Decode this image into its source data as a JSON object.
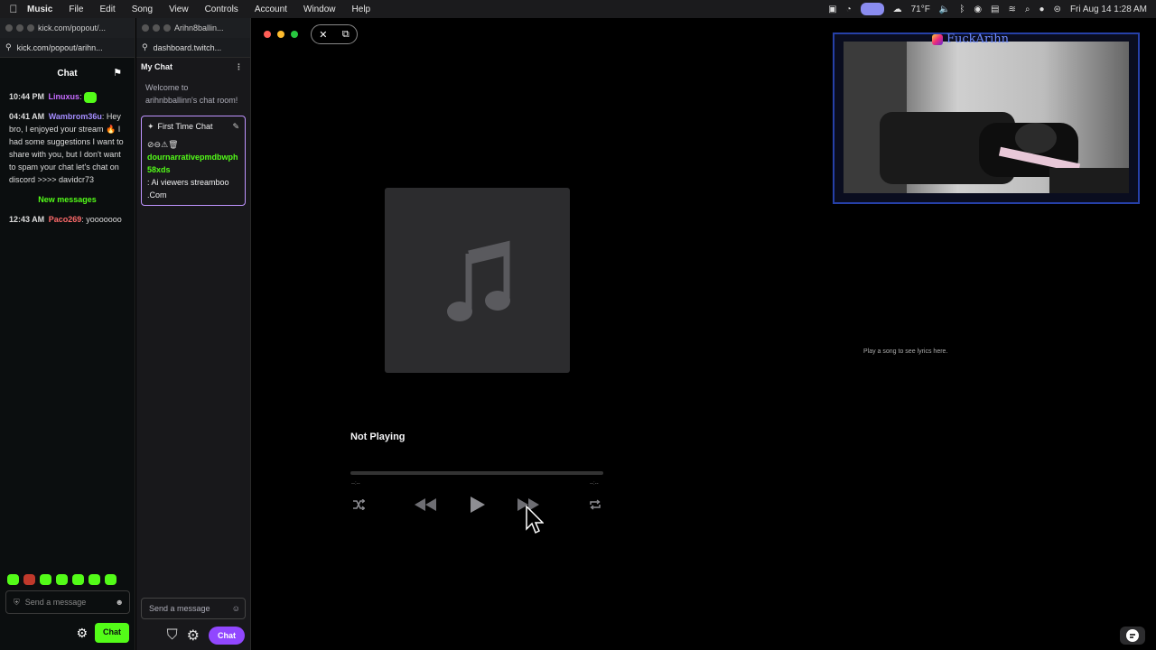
{
  "menubar": {
    "app_name": "Music",
    "menus": [
      "File",
      "Edit",
      "Song",
      "View",
      "Controls",
      "Account",
      "Window",
      "Help"
    ],
    "weather": "71°F",
    "datetime": "Fri Aug 14  1:28 AM"
  },
  "kick": {
    "tab_title": "kick.com/popout/...",
    "url": "kick.com/popout/arihn...",
    "header": "Chat",
    "messages": [
      {
        "time": "10:44 PM",
        "user": "Linuxus",
        "sep": ":",
        "text": ""
      },
      {
        "time": "04:41 AM",
        "user": "Wambrom36u",
        "sep": ":",
        "text": "Hey bro, I enjoyed your stream 🔥 I had some suggestions I want to share with you, but I don't want to spam your chat let's chat on discord >>>> davidcr73"
      },
      {
        "time": "12:43 AM",
        "user": "Paco269",
        "sep": ":",
        "text": "yooooooo"
      }
    ],
    "new_messages": "New messages",
    "input_placeholder": "Send a message",
    "chat_button": "Chat",
    "user_colors": {
      "Linuxus": "#c66cff",
      "Wambrom36u": "#a58dff",
      "Paco269": "#ff6b6b"
    }
  },
  "twitch": {
    "tab_title": "Arihn8ballin...",
    "url": "dashboard.twitch...",
    "header": "My Chat",
    "welcome": "Welcome to arihnbballinn's chat room!",
    "first_time_chat": {
      "label": "First Time Chat",
      "badges": "⊘⊖⚠🗑",
      "username": "dournarrativepmdbwph58xds",
      "message": ": Ai viewers streamboo .Com"
    },
    "input_placeholder": "Send a message",
    "chat_button": "Chat"
  },
  "music": {
    "status": "Not Playing",
    "time_elapsed": "--:--",
    "time_remaining": "--:--",
    "lyrics_hint": "Play a song to see lyrics here."
  },
  "webcam": {
    "handle": "FuckArihn"
  },
  "colors": {
    "kick_green": "#53fc18",
    "twitch_purple": "#9147ff",
    "mac_red": "#ff5f57",
    "mac_yellow": "#febc2e",
    "mac_green": "#28c840"
  }
}
